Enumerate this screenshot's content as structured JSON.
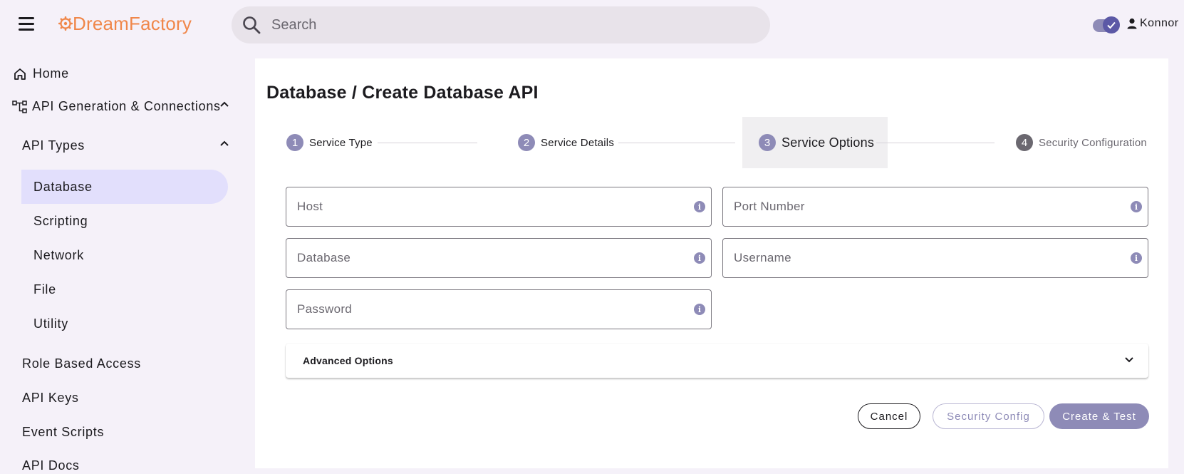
{
  "header": {
    "logo_text": "DreamFactory",
    "search_placeholder": "Search",
    "username": "Konnor"
  },
  "sidebar": {
    "home": "Home",
    "api_generation": "API Generation & Connections",
    "api_types": "API Types",
    "api_type_items": [
      "Database",
      "Scripting",
      "Network",
      "File",
      "Utility"
    ],
    "role_based_access": "Role Based Access",
    "api_keys": "API Keys",
    "event_scripts": "Event Scripts",
    "api_docs": "API Docs"
  },
  "page": {
    "title": "Database / Create Database API"
  },
  "stepper": {
    "steps": [
      {
        "num": "1",
        "label": "Service Type"
      },
      {
        "num": "2",
        "label": "Service Details"
      },
      {
        "num": "3",
        "label": "Service Options"
      },
      {
        "num": "4",
        "label": "Security Configuration"
      }
    ],
    "active_step": 3
  },
  "form": {
    "host_placeholder": "Host",
    "port_placeholder": "Port Number",
    "database_placeholder": "Database",
    "username_placeholder": "Username",
    "password_placeholder": "Password",
    "info_glyph": "i",
    "advanced_options": "Advanced Options"
  },
  "actions": {
    "cancel": "Cancel",
    "security_config": "Security Config",
    "create_test": "Create & Test"
  },
  "colors": {
    "brand_orange": "#f0874a",
    "accent_purple": "#8e8bb7",
    "active_nav_bg": "#e2dffc"
  }
}
